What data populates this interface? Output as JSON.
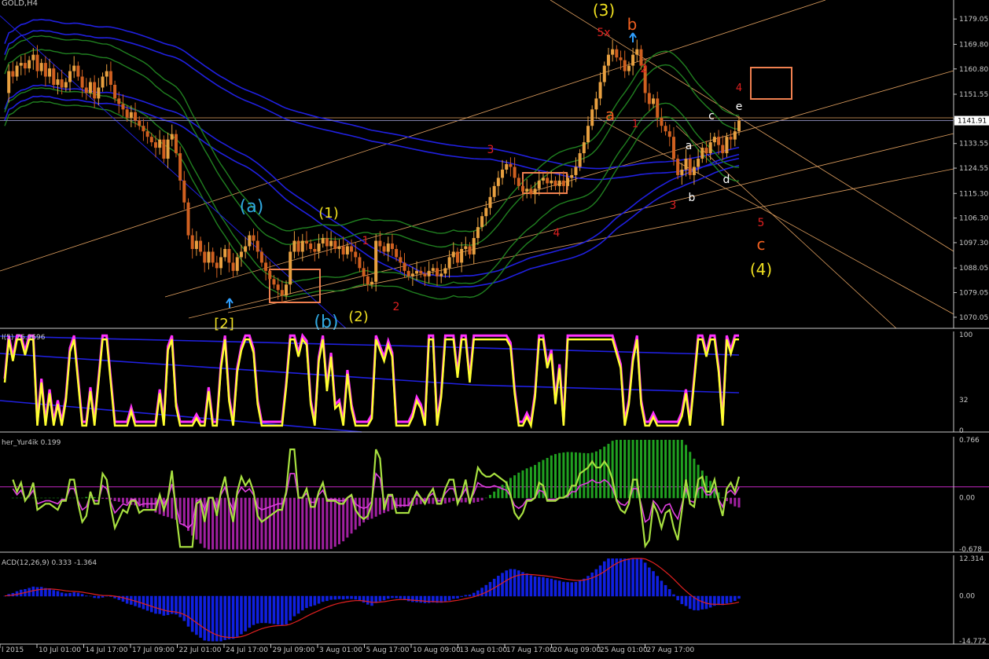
{
  "chart_data": [
    {
      "type": "candlestick",
      "symbol_label": "GOLD,H4",
      "ylim": [
        1066,
        1186
      ],
      "y_ticks": [
        "1179.05",
        "1169.80",
        "1160.80",
        "1151.55",
        "1142.55",
        "1133.55",
        "1124.55",
        "1115.30",
        "1106.30",
        "1097.30",
        "1088.05",
        "1079.05",
        "1070.05"
      ],
      "current_price": "1141.91",
      "candles": [
        1152,
        1160,
        1158,
        1162,
        1163,
        1161,
        1164,
        1166,
        1160,
        1163,
        1158,
        1161,
        1155,
        1157,
        1154,
        1156,
        1160,
        1162,
        1158,
        1154,
        1152,
        1156,
        1150,
        1154,
        1158,
        1160,
        1155,
        1150,
        1148,
        1146,
        1143,
        1145,
        1142,
        1140,
        1138,
        1136,
        1134,
        1132,
        1135,
        1128,
        1135,
        1137,
        1130,
        1120,
        1112,
        1100,
        1095,
        1098,
        1094,
        1090,
        1094,
        1090,
        1088,
        1092,
        1095,
        1090,
        1087,
        1092,
        1094,
        1096,
        1100,
        1098,
        1094,
        1090,
        1087,
        1084,
        1082,
        1080,
        1078,
        1082,
        1094,
        1098,
        1094,
        1098,
        1097,
        1095,
        1094,
        1097,
        1099,
        1096,
        1098,
        1095,
        1096,
        1093,
        1096,
        1094,
        1092,
        1088,
        1085,
        1082,
        1083,
        1098,
        1096,
        1094,
        1097,
        1095,
        1092,
        1090,
        1087,
        1085,
        1086,
        1087,
        1086,
        1085,
        1087,
        1088,
        1085,
        1086,
        1088,
        1092,
        1094,
        1090,
        1095,
        1096,
        1093,
        1099,
        1103,
        1107,
        1110,
        1114,
        1118,
        1121,
        1124,
        1126,
        1125,
        1121,
        1118,
        1116,
        1117,
        1115,
        1117,
        1120,
        1121,
        1119,
        1120,
        1118,
        1120,
        1118,
        1121,
        1122,
        1125,
        1130,
        1134,
        1140,
        1146,
        1150,
        1156,
        1162,
        1166,
        1168,
        1165,
        1164,
        1160,
        1162,
        1166,
        1168,
        1162,
        1152,
        1148,
        1150,
        1143,
        1140,
        1138,
        1136,
        1128,
        1122,
        1124,
        1128,
        1122,
        1125,
        1128,
        1132,
        1130,
        1134,
        1136,
        1133,
        1130,
        1136,
        1135,
        1138,
        1142
      ],
      "wave_labels": [
        "(3)",
        "b",
        "5x",
        "2",
        "4",
        "e",
        "a",
        "1",
        "c",
        "a",
        "3",
        "b",
        "d",
        "3",
        "5",
        "c",
        "(4)",
        "(a)",
        "(1)",
        "1",
        "(2)",
        "(b)",
        "2",
        "4",
        "[2]"
      ]
    },
    {
      "type": "line",
      "indicator_label": "I(5) 76.9696",
      "ylim": [
        0,
        100
      ],
      "y_ticks": [
        "100",
        "32",
        "0"
      ]
    },
    {
      "type": "bar",
      "indicator_label": "her_Yur4ik 0.199",
      "ylim": [
        -0.678,
        0.766
      ],
      "y_ticks": [
        "0.766",
        "0.00",
        "-0.678"
      ]
    },
    {
      "type": "bar",
      "indicator_label": "ACD(12,26,9) 0.333 -1.364",
      "ylim": [
        -14.772,
        12.314
      ],
      "y_ticks": [
        "12.314",
        "0.00",
        "-14.772"
      ]
    }
  ],
  "x_axis": {
    "labels": [
      "l 2015",
      "10 Jul 01:00",
      "14 Jul 17:00",
      "17 Jul 09:00",
      "22 Jul 01:00",
      "24 Jul 17:00",
      "29 Jul 09:00",
      "3 Aug 01:00",
      "5 Aug 17:00",
      "10 Aug 09:00",
      "13 Aug 01:00",
      "17 Aug 17:00",
      "20 Aug 09:00",
      "25 Aug 01:00",
      "27 Aug 17:00"
    ]
  },
  "colors": {
    "background": "#000000",
    "bull": "#e8a040",
    "bear": "#d06020",
    "axis_text": "#c8c8c8",
    "wave_red": "#e02020",
    "wave_yellow": "#f0e020",
    "wave_cyan": "#30a8e0",
    "wave_orange": "#f06020",
    "stoch_main": "#ffff30",
    "stoch_band": "#ff30ff",
    "hist_green": "#20a020",
    "hist_purple": "#a020a0",
    "osc_line": "#a8e040",
    "macd_hist": "#1020e0",
    "signal": "#e02020",
    "blue_env": "#2020e0",
    "green_env": "#208020",
    "fib_line": "#e0a060"
  }
}
